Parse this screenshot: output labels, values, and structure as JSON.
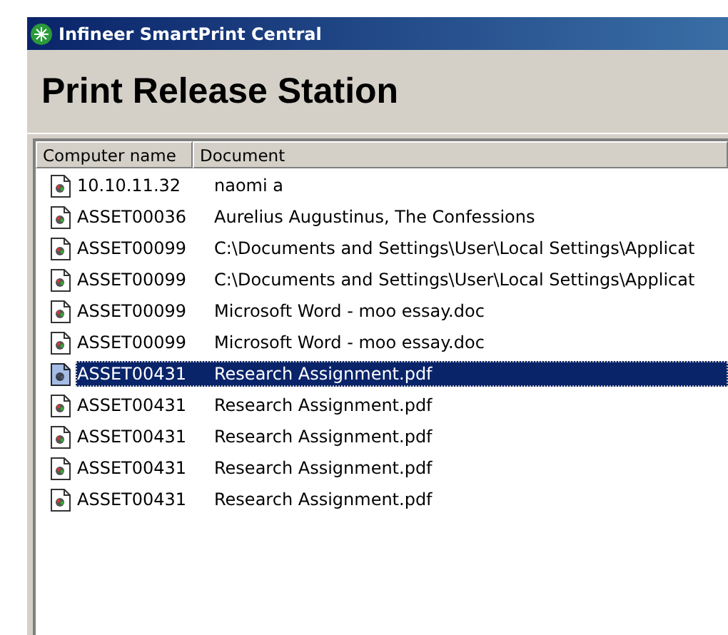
{
  "window": {
    "title": "Infineer SmartPrint Central"
  },
  "header": {
    "title": "Print Release Station"
  },
  "list": {
    "columns": [
      "Computer name",
      "Document"
    ],
    "rows": [
      {
        "computer": "10.10.11.32",
        "document": "naomi a",
        "selected": false
      },
      {
        "computer": "ASSET00036",
        "document": "Aurelius Augustinus, The Confessions",
        "selected": false
      },
      {
        "computer": "ASSET00099",
        "document": "C:\\Documents and Settings\\User\\Local Settings\\Applicat",
        "selected": false
      },
      {
        "computer": "ASSET00099",
        "document": "C:\\Documents and Settings\\User\\Local Settings\\Applicat",
        "selected": false
      },
      {
        "computer": "ASSET00099",
        "document": "Microsoft Word - moo essay.doc",
        "selected": false
      },
      {
        "computer": "ASSET00099",
        "document": "Microsoft Word - moo essay.doc",
        "selected": false
      },
      {
        "computer": "ASSET00431",
        "document": "Research Assignment.pdf",
        "selected": true
      },
      {
        "computer": "ASSET00431",
        "document": "Research Assignment.pdf",
        "selected": false
      },
      {
        "computer": "ASSET00431",
        "document": "Research Assignment.pdf",
        "selected": false
      },
      {
        "computer": "ASSET00431",
        "document": "Research Assignment.pdf",
        "selected": false
      },
      {
        "computer": "ASSET00431",
        "document": "Research Assignment.pdf",
        "selected": false
      }
    ]
  }
}
